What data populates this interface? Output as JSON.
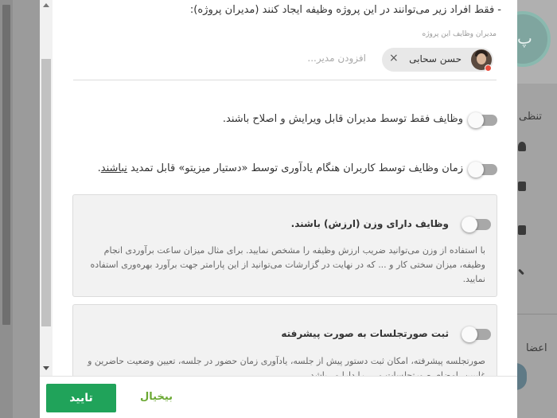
{
  "background": {
    "avatar_letter": "پ",
    "settings_text": "تنظی",
    "members_text": "اعضا"
  },
  "modal": {
    "intro_text": "- فقط افراد زیر می‌توانند در این پروژه وظیفه ایجاد کنند (مدیران پروژه):",
    "managers_label": "مدیران وظایف این پروژه",
    "manager_chip": {
      "name": "حسن سحابی",
      "remove_icon": "×",
      "status_color": "#e74c3c"
    },
    "add_manager_placeholder": "افزودن مدیر...",
    "settings": [
      {
        "text": "وظایف فقط توسط مدیران قابل ویرایش و اصلاح باشند.",
        "enabled": false
      },
      {
        "text_before": "زمان وظایف توسط کاربران هنگام یادآوری توسط «دستیار میزیتو» قابل تمدید ",
        "text_underlined": "نباشند",
        "text_after": ".",
        "enabled": false
      }
    ],
    "cards": [
      {
        "title": "وظایف دارای وزن (ارزش) باشند.",
        "description": "با استفاده از وزن می‌توانید ضریب ارزش وظیفه را مشخص نمایید. برای مثال میزان ساعت برآوردی انجام وظیفه، میزان سختی کار و ... که در نهایت در گزارشات می‌توانید از این پارامتر جهت برآورد بهره‌وری استفاده نمایید.",
        "enabled": false
      },
      {
        "title": "ثبت صورتجلسات به صورت پیشرفته",
        "description": "صورتجلسه پیشرفته، امکان ثبت دستور پیش از جلسه، یادآوری زمان حضور در جلسه، تعیین وضعیت حاضرین و غایبین، امضای صورتجلسات و ... را دارا می‌باشد.",
        "enabled": false
      }
    ],
    "footer": {
      "confirm_label": "تایید",
      "cancel_label": "بیخیال"
    }
  },
  "colors": {
    "confirm_green": "#20a35a",
    "cancel_green": "#6aa832",
    "toggle_off": "#a8a8a8",
    "card_bg": "#f2f2f2"
  }
}
